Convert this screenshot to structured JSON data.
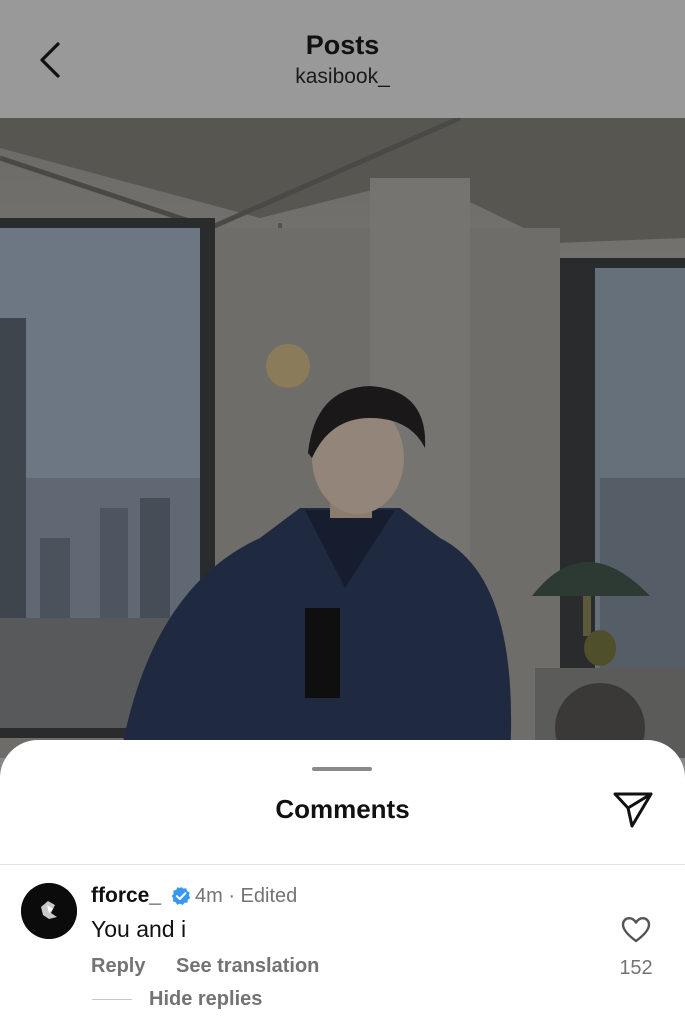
{
  "header": {
    "title": "Posts",
    "username": "kasibook_",
    "back_icon": "chevron-left-icon"
  },
  "post": {
    "image_alt": "photo-of-person-by-window"
  },
  "comments_sheet": {
    "title": "Comments",
    "share_icon": "send-icon",
    "comment": {
      "username": "fforce_",
      "verified_icon": "verified-badge-icon",
      "meta": "4m · Edited",
      "text": "You and i",
      "reply_label": "Reply",
      "translate_label": "See translation",
      "like_icon": "heart-outline-icon",
      "like_count": "152",
      "hide_replies_label": "Hide replies"
    }
  },
  "colors": {
    "verified_blue": "#3897f0",
    "secondary_text": "#737373",
    "overlay": "#999999"
  }
}
